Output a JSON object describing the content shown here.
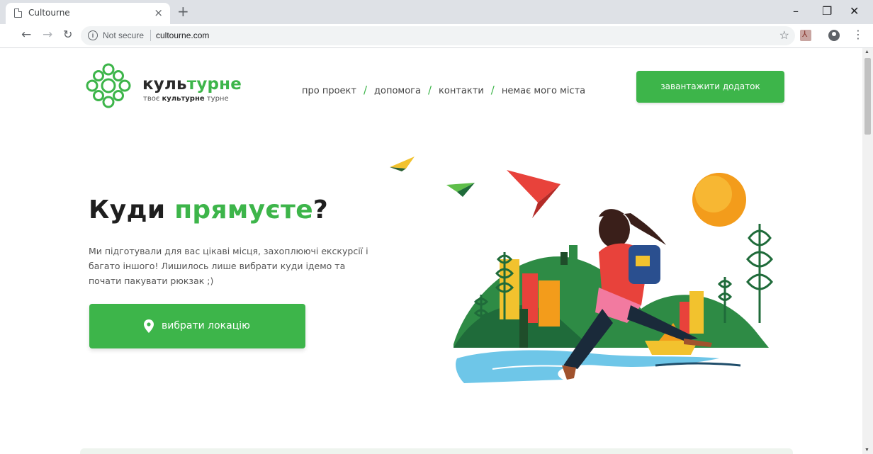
{
  "browser": {
    "tab_title": "Cultourne",
    "tab_close": "×",
    "new_tab": "+",
    "security_text": "Not secure",
    "url": "cultourne.com",
    "minimize": "–",
    "restore": "❐",
    "close": "✕"
  },
  "site": {
    "brand_dark": "куль",
    "brand_green": "турне",
    "tagline_pre": "твоє ",
    "tagline_bold": "культурне",
    "tagline_post": " турне",
    "nav": [
      "про проект",
      "допомога",
      "контакти",
      "немає мого міста"
    ],
    "nav_separator": "/",
    "download_button": "завантажити додаток"
  },
  "hero": {
    "title_main": "Куди ",
    "title_accent": "прямуєте",
    "title_end": "?",
    "description": "Ми підготували для вас цікаві місця, захоплюючі екскурсії і багато іншого! Лишилось лише вибрати куди ідемо та почати пакувати рюкзак ;)",
    "location_button": "вибрати локацію"
  },
  "colors": {
    "brand_green": "#3db54a",
    "sun_orange": "#f39c1b",
    "water_blue": "#6ec6e8",
    "shirt_red": "#e8423b",
    "dark_green": "#1f6b3a"
  },
  "icons": {
    "location": "map-pin-icon",
    "logo": "cultourne-logo-icon"
  }
}
